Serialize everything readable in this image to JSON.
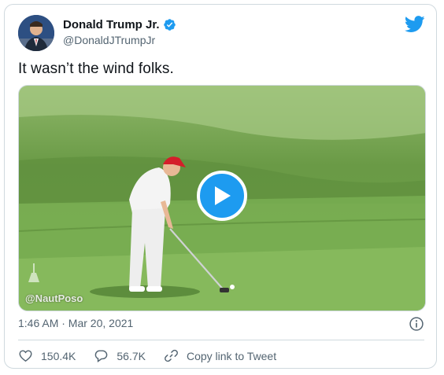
{
  "author": {
    "display_name": "Donald Trump Jr.",
    "handle": "@DonaldJTrumpJr"
  },
  "tweet": {
    "text": "It wasn’t the wind folks.",
    "timestamp": "1:46 AM · Mar 20, 2021"
  },
  "media": {
    "watermark": "@NautPoso"
  },
  "actions": {
    "likes": "150.4K",
    "replies": "56.7K",
    "copy_link_label": "Copy link to Tweet"
  },
  "colors": {
    "accent": "#1d9bf0",
    "text_primary": "#0f1419",
    "text_secondary": "#536471",
    "border": "#cfd9de"
  },
  "icons": [
    "avatar",
    "verified-badge-icon",
    "twitter-bird-icon",
    "play-icon",
    "info-icon",
    "heart-icon",
    "reply-icon",
    "link-icon"
  ]
}
